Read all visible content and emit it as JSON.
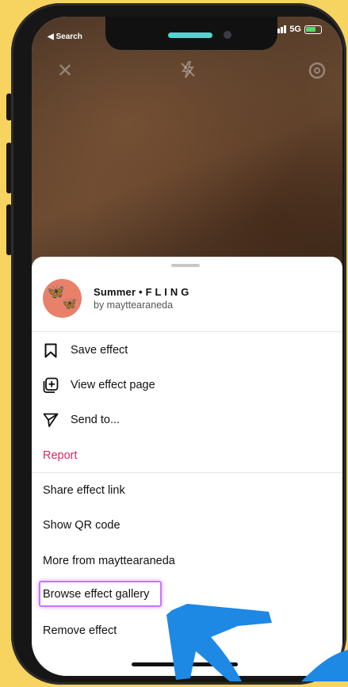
{
  "status": {
    "back_label": "◀ Search",
    "network": "5G"
  },
  "effect": {
    "name": "Summer • F L I N G",
    "author": "by mayttearaneda"
  },
  "menu": {
    "save": "Save effect",
    "view": "View effect page",
    "send": "Send to...",
    "report": "Report",
    "share_link": "Share effect link",
    "qr": "Show QR code",
    "more_from": "More from mayttearaneda",
    "browse": "Browse effect gallery",
    "remove": "Remove effect"
  },
  "colors": {
    "background": "#f7d35f",
    "report": "#e0245e",
    "highlight": "#c774ff",
    "arrow": "#1e88e5"
  }
}
